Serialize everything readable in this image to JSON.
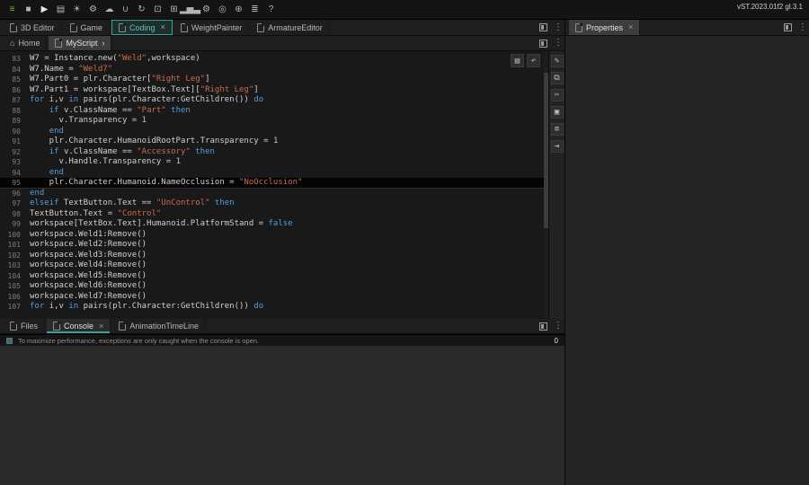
{
  "ui": {
    "close_glyph": "×",
    "accent": "#36a396"
  },
  "toolbar": {
    "version": "vST.2023.01f2 gl.3.1",
    "icons": [
      "menu",
      "stop",
      "play",
      "save",
      "sun",
      "gear",
      "cloud",
      "magnet",
      "rotate",
      "scale",
      "grid",
      "stats",
      "settings",
      "target",
      "globe",
      "layers",
      "help"
    ]
  },
  "doc_tabs": {
    "tabs": [
      {
        "label": "3D Editor",
        "icon": "doc"
      },
      {
        "label": "Game",
        "icon": "doc"
      },
      {
        "label": "Coding",
        "icon": "doc",
        "active": true,
        "closable": true
      },
      {
        "label": "WeightPainter",
        "icon": "doc"
      },
      {
        "label": "ArmatureEditor",
        "icon": "doc"
      }
    ]
  },
  "script_tabs": {
    "tabs": [
      {
        "label": "Home",
        "icon": "home"
      },
      {
        "label": "MyScript",
        "icon": "doc",
        "active": true,
        "chevron": "›"
      }
    ]
  },
  "editor": {
    "quick_actions": [
      "save",
      "undo"
    ],
    "side_toolbar": [
      "pencil",
      "copy",
      "cut",
      "paste",
      "format",
      "indent"
    ],
    "highlighted_line": 95,
    "lines": [
      {
        "n": 83,
        "segs": [
          [
            "W7 = Instance.new(",
            "p"
          ],
          [
            "\"Weld\"",
            "s"
          ],
          [
            ",workspace)",
            "p"
          ]
        ]
      },
      {
        "n": 84,
        "segs": [
          [
            "W7.Name = ",
            "p"
          ],
          [
            "\"Weld7\"",
            "s"
          ]
        ]
      },
      {
        "n": 85,
        "segs": [
          [
            "W7.Part0 = plr.Character[",
            "p"
          ],
          [
            "\"Right Leg\"",
            "s"
          ],
          [
            "]",
            "p"
          ]
        ]
      },
      {
        "n": 86,
        "segs": [
          [
            "W7.Part1 = workspace[TextBox.Text][",
            "p"
          ],
          [
            "\"Right Leg\"",
            "s"
          ],
          [
            "]",
            "p"
          ]
        ]
      },
      {
        "n": 87,
        "segs": [
          [
            "for",
            "k"
          ],
          [
            " i,v ",
            "p"
          ],
          [
            "in",
            "k"
          ],
          [
            " pairs(plr.Character:GetChildren()) ",
            "p"
          ],
          [
            "do",
            "k"
          ]
        ]
      },
      {
        "n": 88,
        "segs": [
          [
            "    ",
            "p"
          ],
          [
            "if",
            "k"
          ],
          [
            " v.ClassName == ",
            "p"
          ],
          [
            "\"Part\"",
            "s"
          ],
          [
            " ",
            "p"
          ],
          [
            "then",
            "k"
          ]
        ]
      },
      {
        "n": 89,
        "segs": [
          [
            "      v.Transparency = ",
            "p"
          ],
          [
            "1",
            "n"
          ]
        ]
      },
      {
        "n": 90,
        "segs": [
          [
            "    ",
            "p"
          ],
          [
            "end",
            "k"
          ]
        ]
      },
      {
        "n": 91,
        "segs": [
          [
            "    plr.Character.HumanoidRootPart.Transparency = ",
            "p"
          ],
          [
            "1",
            "n"
          ]
        ]
      },
      {
        "n": 92,
        "segs": [
          [
            "    ",
            "p"
          ],
          [
            "if",
            "k"
          ],
          [
            " v.ClassName == ",
            "p"
          ],
          [
            "\"Accessory\"",
            "s"
          ],
          [
            " ",
            "p"
          ],
          [
            "then",
            "k"
          ]
        ]
      },
      {
        "n": 93,
        "segs": [
          [
            "      v.Handle.Transparency = ",
            "p"
          ],
          [
            "1",
            "n"
          ]
        ]
      },
      {
        "n": 94,
        "segs": [
          [
            "    ",
            "p"
          ],
          [
            "end",
            "k"
          ]
        ]
      },
      {
        "n": 95,
        "segs": [
          [
            "    plr.Character.Humanoid.NameOcclusion = ",
            "p"
          ],
          [
            "\"NoOcclusion\"",
            "s"
          ]
        ]
      },
      {
        "n": 96,
        "segs": [
          [
            "end",
            "k"
          ]
        ]
      },
      {
        "n": 97,
        "segs": [
          [
            "elseif",
            "k"
          ],
          [
            " TextButton.Text == ",
            "p"
          ],
          [
            "\"UnControl\"",
            "s"
          ],
          [
            " ",
            "p"
          ],
          [
            "then",
            "k"
          ]
        ]
      },
      {
        "n": 98,
        "segs": [
          [
            "TextButton.Text = ",
            "p"
          ],
          [
            "\"Control\"",
            "s"
          ]
        ]
      },
      {
        "n": 99,
        "segs": [
          [
            "workspace[TextBox.Text].Humanoid.PlatformStand = ",
            "p"
          ],
          [
            "false",
            "k"
          ]
        ]
      },
      {
        "n": 100,
        "segs": [
          [
            "workspace.Weld1:Remove()",
            "p"
          ]
        ]
      },
      {
        "n": 101,
        "segs": [
          [
            "workspace.Weld2:Remove()",
            "p"
          ]
        ]
      },
      {
        "n": 102,
        "segs": [
          [
            "workspace.Weld3:Remove()",
            "p"
          ]
        ]
      },
      {
        "n": 103,
        "segs": [
          [
            "workspace.Weld4:Remove()",
            "p"
          ]
        ]
      },
      {
        "n": 104,
        "segs": [
          [
            "workspace.Weld5:Remove()",
            "p"
          ]
        ]
      },
      {
        "n": 105,
        "segs": [
          [
            "workspace.Weld6:Remove()",
            "p"
          ]
        ]
      },
      {
        "n": 106,
        "segs": [
          [
            "workspace.Weld7:Remove()",
            "p"
          ]
        ]
      },
      {
        "n": 107,
        "segs": [
          [
            "for",
            "k"
          ],
          [
            " i,v ",
            "p"
          ],
          [
            "in",
            "k"
          ],
          [
            " pairs(plr.Character:GetChildren()) ",
            "p"
          ],
          [
            "do",
            "k"
          ]
        ]
      }
    ]
  },
  "bottom_tabs": {
    "tabs": [
      {
        "label": "Files",
        "icon": "doc"
      },
      {
        "label": "Console",
        "icon": "doc",
        "active": true,
        "closable": true
      },
      {
        "label": "AnimationTimeLine",
        "icon": "doc"
      }
    ]
  },
  "console": {
    "message": "To maximize performance, exceptions are only caught when the console is open.",
    "count": "0"
  },
  "properties_panel": {
    "tabs": [
      {
        "label": "Properties",
        "icon": "doc",
        "active": true,
        "closable": true
      }
    ]
  }
}
